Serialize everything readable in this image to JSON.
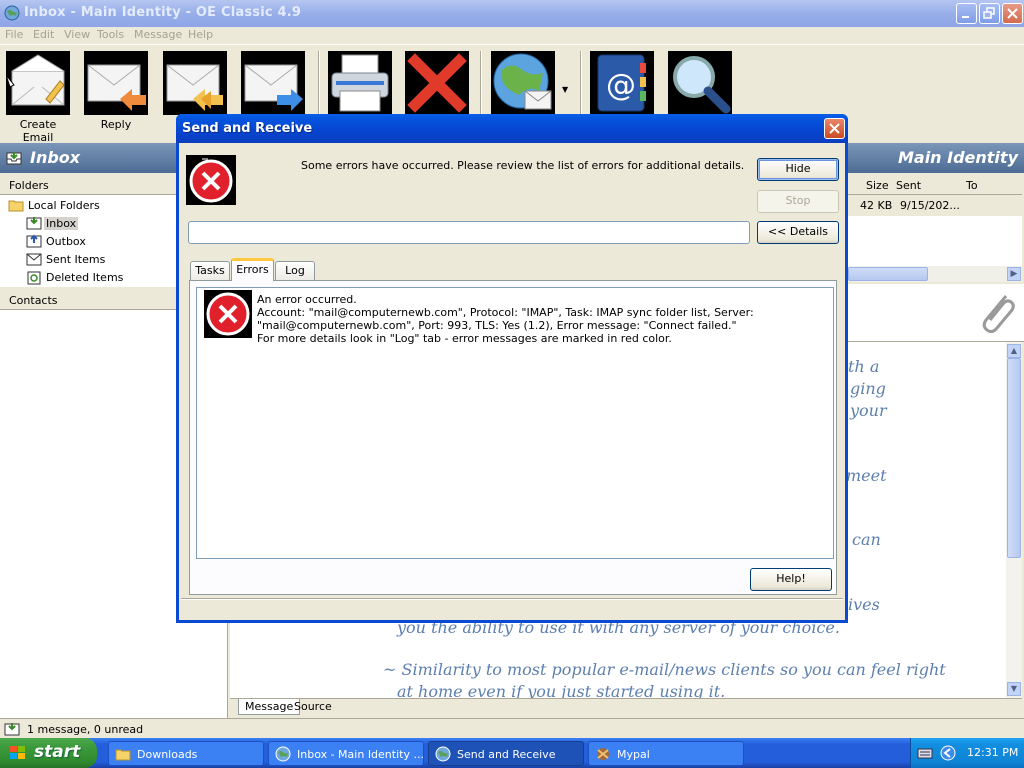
{
  "window": {
    "title": "Inbox - Main Identity - OE Classic 4.9"
  },
  "menu": [
    "File",
    "Edit",
    "View",
    "Tools",
    "Message",
    "Help"
  ],
  "toolbar": {
    "create_email": "Create Email",
    "reply": "Reply"
  },
  "band": {
    "folder": "Inbox",
    "identity": "Main Identity"
  },
  "folders_pane": {
    "header": "Folders",
    "items": [
      {
        "label": "Local Folders"
      },
      {
        "label": "Inbox"
      },
      {
        "label": "Outbox"
      },
      {
        "label": "Sent Items"
      },
      {
        "label": "Deleted Items"
      }
    ]
  },
  "contacts_pane": {
    "header": "Contacts"
  },
  "message_list": {
    "columns": [
      "Size",
      "Sent",
      "To"
    ],
    "row": {
      "size": "42 KB",
      "sent": "9/15/202..."
    }
  },
  "preview": {
    "fragments": [
      "th a",
      "ging",
      "your",
      "meet",
      "can",
      "ives",
      "you the ability to use it with any server of your choice.",
      "~ Similarity to most popular e-mail/news clients so you can feel right",
      "at home even if you just started using it."
    ]
  },
  "message_tabs": [
    "Message",
    "Source"
  ],
  "statusbar": {
    "text": "1 message, 0 unread"
  },
  "taskbar": {
    "start": "start",
    "tasks": [
      "Downloads",
      "Inbox - Main Identity ...",
      "Send and Receive",
      "Mypal"
    ],
    "clock": "12:31 PM"
  },
  "dialog": {
    "title": "Send and Receive",
    "message": "Some errors have occurred. Please review the list of errors for additional details.",
    "buttons": {
      "hide": "Hide",
      "stop": "Stop",
      "details": "<< Details",
      "help": "Help!"
    },
    "tabs": [
      "Tasks",
      "Errors",
      "Log"
    ],
    "active_tab": "Errors",
    "error": {
      "lines": [
        "An error occurred.",
        "Account: \"mail@computernewb.com\", Protocol: \"IMAP\", Task: IMAP sync folder list, Server:",
        "\"mail@computernewb.com\", Port: 993, TLS: Yes (1.2), Error message: \"Connect failed.\"",
        "For more details look in \"Log\" tab - error messages are marked in red color."
      ]
    }
  },
  "colors": {
    "accent": "#0a4ad3",
    "band": "#4d6b93",
    "error_red": "#e0202a",
    "preview_text": "#5d7fae"
  }
}
